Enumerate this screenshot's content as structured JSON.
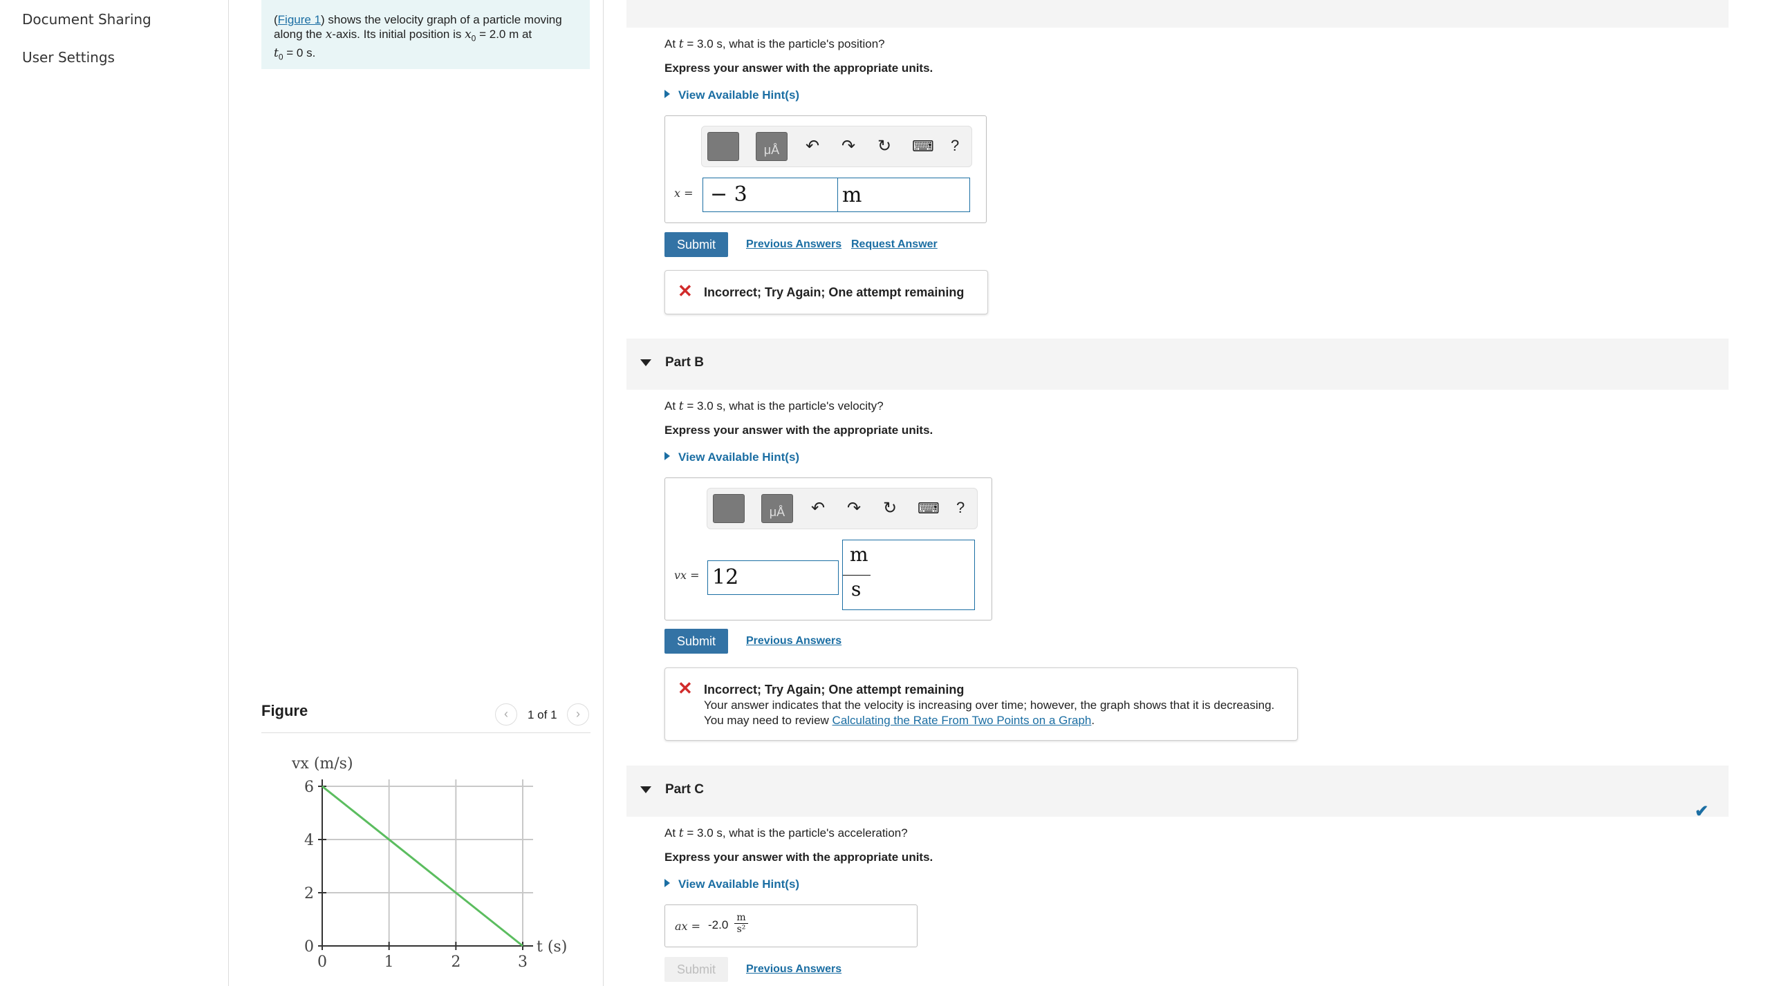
{
  "sidebar": {
    "items": [
      {
        "label": "Document Sharing"
      },
      {
        "label": "User Settings"
      }
    ]
  },
  "intro": {
    "pre": "(",
    "figure_link": "Figure 1",
    "text1": ") shows the velocity graph of a particle moving along the ",
    "x_sym": "x",
    "text2": "-axis. Its initial position is ",
    "x0_sym": "x",
    "x0_sub": "0",
    "x0_val": " = 2.0 m at",
    "t0_sym": "t",
    "t0_sub": "0",
    "t0_val": " = 0 s."
  },
  "figure": {
    "title": "Figure",
    "pager": "1 of 1",
    "prev_icon": "chevron-left-icon",
    "next_icon": "chevron-right-icon"
  },
  "chart_data": {
    "type": "line",
    "x": [
      0,
      3
    ],
    "series": [
      {
        "values": [
          6,
          0
        ]
      }
    ],
    "xlabel": "t (s)",
    "ylabel": "vx (m/s)",
    "x_ticks": [
      "0",
      "1",
      "2",
      "3"
    ],
    "y_ticks": [
      "0",
      "2",
      "4",
      "6"
    ],
    "xlim": [
      0,
      3
    ],
    "ylim": [
      0,
      6
    ],
    "grid": true,
    "line_color": "#5bbd5f"
  },
  "partA": {
    "question_pre": "At ",
    "t_sym": "t",
    "question_post": " = 3.0 s, what is the particle's position?",
    "instruction": "Express your answer with the appropriate units.",
    "hint": "View Available Hint(s)",
    "var_label": "x =",
    "value": "− 3",
    "unit": "m",
    "submit": "Submit",
    "prev_answers": "Previous Answers",
    "request_answer": "Request Answer",
    "feedback": "Incorrect; Try Again; One attempt remaining"
  },
  "partB": {
    "title": "Part B",
    "question_pre": "At ",
    "t_sym": "t",
    "question_post": " = 3.0 s, what is the particle's velocity?",
    "instruction": "Express your answer with the appropriate units.",
    "hint": "View Available Hint(s)",
    "var_label": "vx =",
    "value": "12",
    "unit_num": "m",
    "unit_den": "s",
    "submit": "Submit",
    "prev_answers": "Previous Answers",
    "feedback_title": "Incorrect; Try Again; One attempt remaining",
    "feedback_line1": "Your answer indicates that the velocity is increasing over time; however, the graph shows that it is decreasing.",
    "feedback_line2_pre": "You may need to review ",
    "feedback_link": "Calculating the Rate From Two Points on a Graph",
    "feedback_line2_post": "."
  },
  "partC": {
    "title": "Part C",
    "question_pre": "At ",
    "t_sym": "t",
    "question_post": " = 3.0 s, what is the particle's acceleration?",
    "instruction": "Express your answer with the appropriate units.",
    "hint": "View Available Hint(s)",
    "var_label": "ax =",
    "value": "-2.0",
    "unit_num": "m",
    "unit_den": "s²",
    "submit": "Submit",
    "prev_answers": "Previous Answers",
    "status_icon": "checkmark-icon"
  },
  "toolbar": {
    "icons": [
      "templates-icon",
      "units-icon",
      "undo-icon",
      "redo-icon",
      "reset-icon",
      "keyboard-icon",
      "help-icon"
    ],
    "units_label": "μÅ",
    "help_label": "?"
  },
  "colors": {
    "accent": "#1b6ea3",
    "submit": "#3373a5",
    "error": "#d12b2b",
    "intro_bg": "#e9f5f6",
    "part_bar": "#f4f4f4"
  }
}
